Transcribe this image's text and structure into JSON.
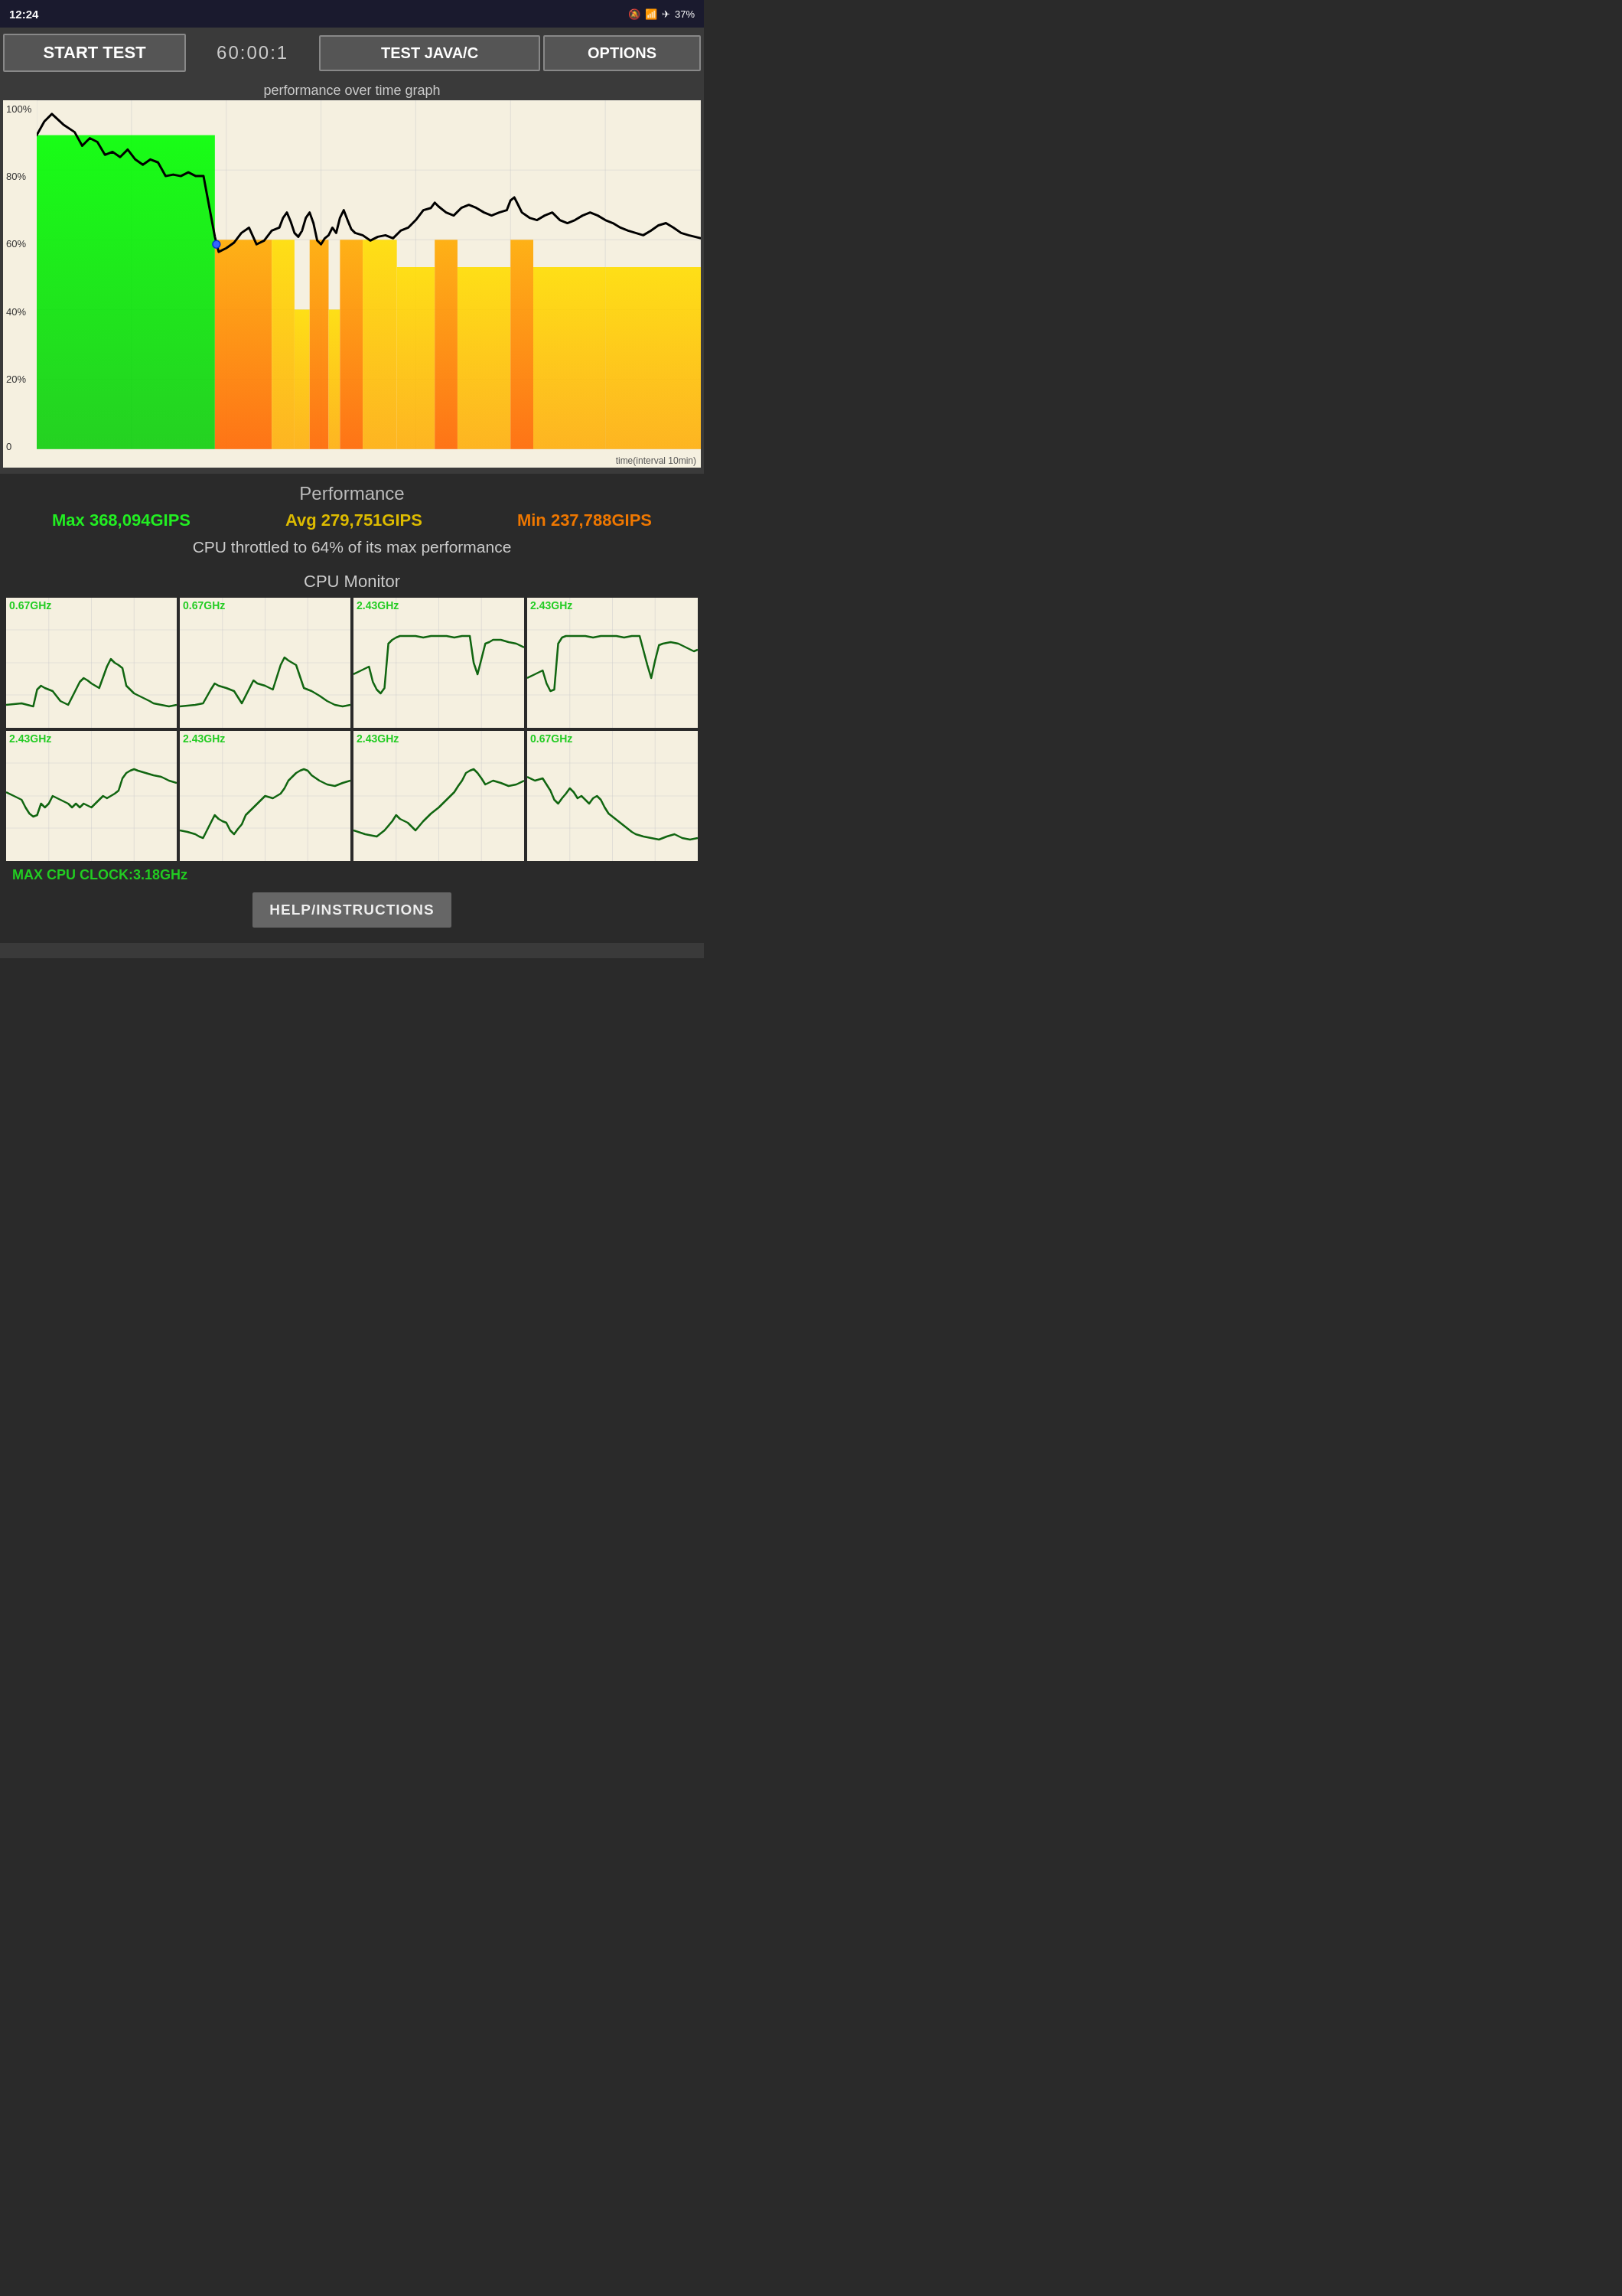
{
  "statusBar": {
    "time": "12:24",
    "battery": "37%"
  },
  "toolbar": {
    "startLabel": "START TEST",
    "timer": "60:00:1",
    "testLabel": "TEST JAVA/C",
    "optionsLabel": "OPTIONS"
  },
  "graph": {
    "title": "performance over time graph",
    "yLabels": [
      "100%",
      "80%",
      "60%",
      "40%",
      "20%",
      "0"
    ],
    "timeLabel": "time(interval 10min)"
  },
  "performance": {
    "title": "Performance",
    "max": "Max 368,094GIPS",
    "avg": "Avg 279,751GIPS",
    "min": "Min 237,788GIPS",
    "throttleText": "CPU throttled to 64% of its max performance"
  },
  "cpuMonitor": {
    "title": "CPU Monitor",
    "cores": [
      {
        "freq": "0.67GHz"
      },
      {
        "freq": "0.67GHz"
      },
      {
        "freq": "2.43GHz"
      },
      {
        "freq": "2.43GHz"
      },
      {
        "freq": "2.43GHz"
      },
      {
        "freq": "2.43GHz"
      },
      {
        "freq": "2.43GHz"
      },
      {
        "freq": "0.67GHz"
      }
    ],
    "maxClock": "MAX CPU CLOCK:3.18GHz"
  },
  "helpButton": {
    "label": "HELP/INSTRUCTIONS"
  }
}
